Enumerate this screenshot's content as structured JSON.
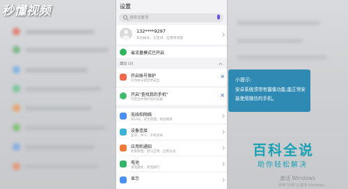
{
  "watermark_logo": "秒懂视频",
  "phone": {
    "title": "设置",
    "search": {
      "placeholder": "搜索设置项"
    },
    "account": {
      "name": "132****9297",
      "detail": "华为帐号、云空间、应用市场等"
    },
    "power_saver": {
      "label": "省流量模式已开启"
    },
    "suggestions": {
      "header": "建议 (2)",
      "items": [
        {
          "title": "开启帐号保护",
          "subtitle": "华为帐号使您更安全",
          "icon_color": "#ef6b4f",
          "close": "✕"
        },
        {
          "title": "开启\"查找我的手机\"",
          "subtitle": "可定位并保护您的设备",
          "icon_color": "#3fb96b",
          "close": "✕"
        }
      ]
    },
    "settings": [
      {
        "title": "无线和网络",
        "subtitle": "WLAN、双卡管理、移动网络",
        "icon": "wifi-icon",
        "icon_color": "#4a8ef0"
      },
      {
        "title": "设备连接",
        "subtitle": "蓝牙、NFC、手机投屏",
        "icon": "device-connect-icon",
        "icon_color": "#3bb1d6"
      },
      {
        "title": "应用和通知",
        "subtitle": "权限管理、默认应用、应用分身",
        "icon": "apps-icon",
        "icon_color": "#f07a3c"
      },
      {
        "title": "电池",
        "subtitle": "省电模式、耗电排行",
        "icon": "battery-icon",
        "icon_color": "#35b56a"
      },
      {
        "title": "显示",
        "subtitle": "",
        "icon": "display-icon",
        "icon_color": "#4a8ef0"
      }
    ]
  },
  "tip": {
    "title": "小提示:",
    "body": "安卓系统须带有摄像功能,能正常安装使用微信的手机。"
  },
  "brand": {
    "name": "百科全说",
    "slogan": "助你轻松解决"
  },
  "windows_watermark": {
    "title": "激活 Windows",
    "subtitle": "转到\"设置\"以激活 Windows。"
  }
}
